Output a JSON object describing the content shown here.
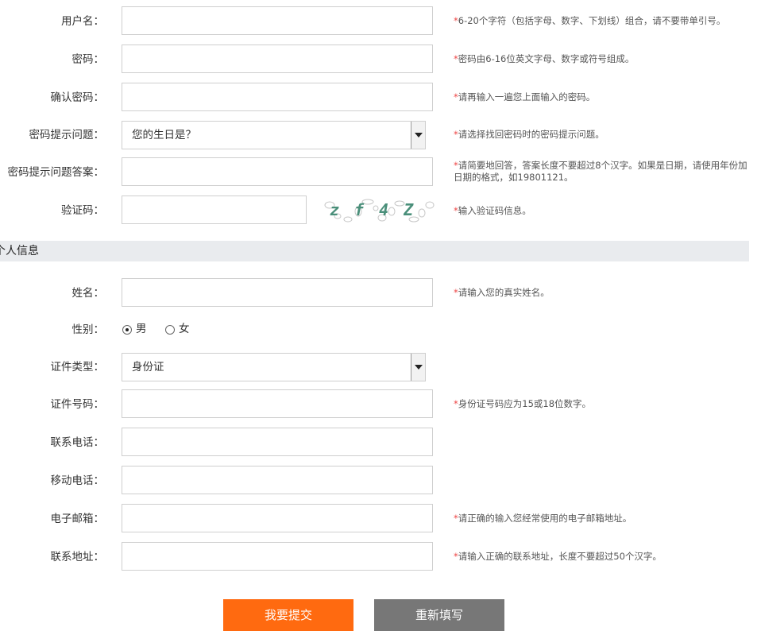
{
  "account": {
    "username": {
      "label": "用户名：",
      "value": "",
      "hint": "6-20个字符（包括字母、数字、下划线）组合，请不要带单引号。"
    },
    "password": {
      "label": "密码：",
      "value": "",
      "hint": "密码由6-16位英文字母、数字或符号组成。"
    },
    "confirm_password": {
      "label": "确认密码：",
      "value": "",
      "hint": "请再输入一遍您上面输入的密码。"
    },
    "question": {
      "label": "密码提示问题：",
      "value": "您的生日是？",
      "hint": "请选择找回密码时的密码提示问题。"
    },
    "answer": {
      "label": "密码提示问题答案：",
      "value": "",
      "hint": "请简要地回答，答案长度不要超过8个汉字。如果是日期，请使用年份加日期的格式，如19801121。"
    },
    "captcha": {
      "label": "验证码：",
      "value": "",
      "image_text": "zf4Z",
      "hint": "输入验证码信息。"
    }
  },
  "section_title": "个人信息",
  "personal": {
    "name": {
      "label": "姓名：",
      "value": "",
      "hint": "请输入您的真实姓名。"
    },
    "gender": {
      "label": "性别：",
      "options": [
        "男",
        "女"
      ],
      "selected": "男"
    },
    "id_type": {
      "label": "证件类型：",
      "value": "身份证"
    },
    "id_number": {
      "label": "证件号码：",
      "value": "",
      "hint": "身份证号码应为15或18位数字。"
    },
    "phone": {
      "label": "联系电话：",
      "value": ""
    },
    "mobile": {
      "label": "移动电话：",
      "value": ""
    },
    "email": {
      "label": "电子邮箱：",
      "value": "",
      "hint": "请正确的输入您经常使用的电子邮箱地址。"
    },
    "address": {
      "label": "联系地址：",
      "value": "",
      "hint": "请输入正确的联系地址，长度不要超过50个汉字。"
    }
  },
  "buttons": {
    "submit": "我要提交",
    "reset": "重新填写"
  },
  "required_mark": "*",
  "colors": {
    "accent": "#ff6a10",
    "hint_star": "#ee4444",
    "section_bg": "#e9ebee",
    "reset_bg": "#777777"
  }
}
